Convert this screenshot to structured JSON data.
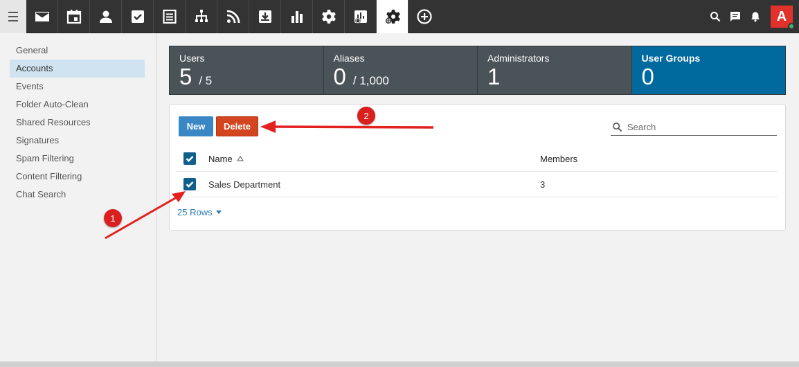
{
  "topbar": {
    "nav_icons": [
      "mail-icon",
      "calendar-icon",
      "contacts-icon",
      "tasks-icon",
      "notes-icon",
      "sitemap-icon",
      "rss-icon",
      "download-icon",
      "reports-icon",
      "settings-icon",
      "domain-reports-icon",
      "admin-settings-icon",
      "add-icon"
    ],
    "avatar_letter": "A",
    "avatar_color": "#e0322b"
  },
  "sidebar": {
    "items": [
      {
        "label": "General"
      },
      {
        "label": "Accounts"
      },
      {
        "label": "Events"
      },
      {
        "label": "Folder Auto-Clean"
      },
      {
        "label": "Shared Resources"
      },
      {
        "label": "Signatures"
      },
      {
        "label": "Spam Filtering"
      },
      {
        "label": "Content Filtering"
      },
      {
        "label": "Chat Search"
      }
    ],
    "active": "Accounts"
  },
  "stats": {
    "users": {
      "label": "Users",
      "value": "5",
      "sub": "/ 5"
    },
    "aliases": {
      "label": "Aliases",
      "value": "0",
      "sub": "/ 1,000"
    },
    "administrators": {
      "label": "Administrators",
      "value": "1"
    },
    "user_groups": {
      "label": "User Groups",
      "value": "0"
    }
  },
  "toolbar": {
    "new_label": "New",
    "delete_label": "Delete",
    "search_placeholder": "Search"
  },
  "table": {
    "columns": {
      "name": "Name",
      "members": "Members"
    },
    "rows": [
      {
        "name": "Sales Department",
        "members": "3",
        "checked": true
      }
    ],
    "rows_per_page": "25 Rows"
  },
  "annotations": {
    "step1": "1",
    "step2": "2",
    "color": "#d9201f"
  }
}
